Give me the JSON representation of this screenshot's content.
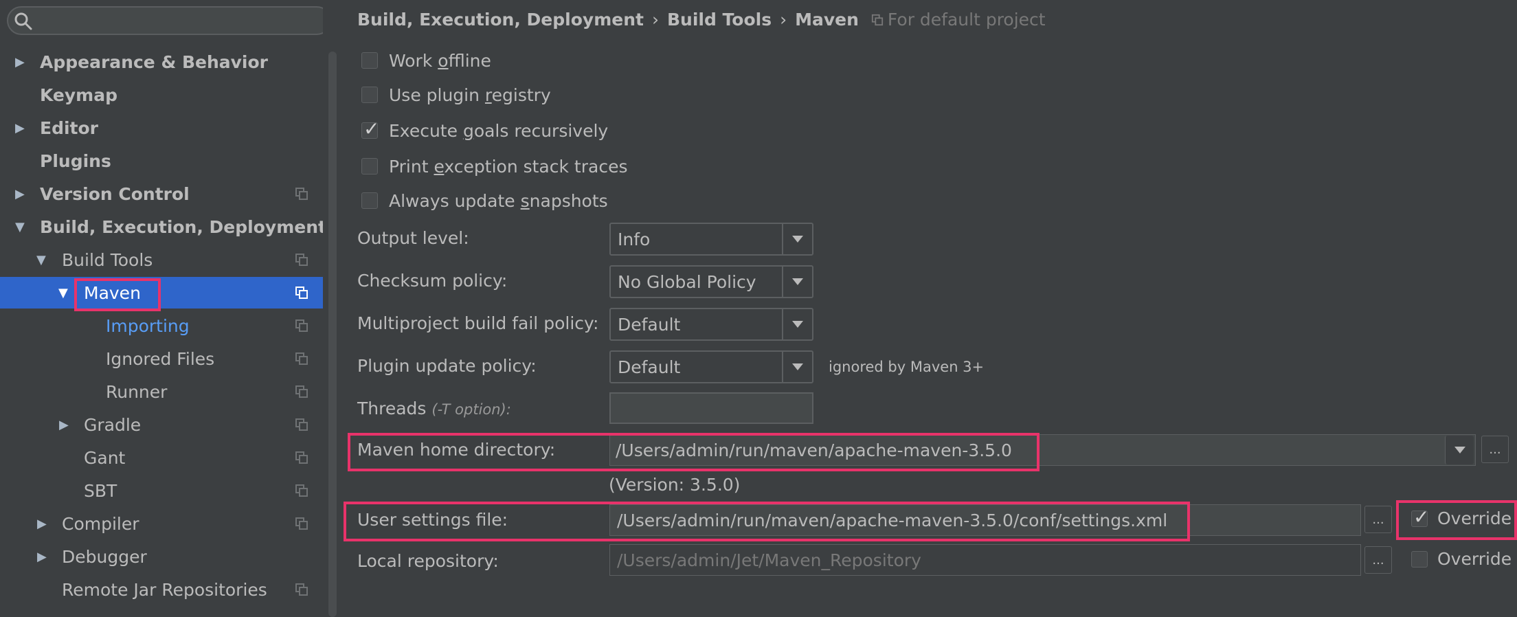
{
  "search": {
    "placeholder": "",
    "value": ""
  },
  "sidebar": {
    "items": [
      {
        "label": "Appearance & Behavior",
        "arrow": "▶"
      },
      {
        "label": "Keymap"
      },
      {
        "label": "Editor",
        "arrow": "▶"
      },
      {
        "label": "Plugins"
      },
      {
        "label": "Version Control",
        "arrow": "▶"
      },
      {
        "label": "Build, Execution, Deployment",
        "arrow": "▼"
      },
      {
        "label": "Build Tools",
        "arrow": "▼"
      },
      {
        "label": "Maven",
        "arrow": "▼"
      },
      {
        "label": "Importing"
      },
      {
        "label": "Ignored Files"
      },
      {
        "label": "Runner"
      },
      {
        "label": "Gradle",
        "arrow": "▶"
      },
      {
        "label": "Gant"
      },
      {
        "label": "SBT"
      },
      {
        "label": "Compiler",
        "arrow": "▶"
      },
      {
        "label": "Debugger",
        "arrow": "▶"
      },
      {
        "label": "Remote Jar Repositories"
      }
    ]
  },
  "breadcrumb": {
    "part1": "Build, Execution, Deployment",
    "part2": "Build Tools",
    "part3": "Maven",
    "separator": "›",
    "scope": "For default project"
  },
  "options": {
    "work_offline": {
      "pre": "Work ",
      "ul": "o",
      "post": "ffline",
      "checked": false
    },
    "use_plugin_registry": {
      "pre": "Use plugin ",
      "ul": "r",
      "post": "egistry",
      "checked": false
    },
    "execute_goals": {
      "pre": "Execute ",
      "ul": "g",
      "post": "oals recursively",
      "checked": true
    },
    "print_exception": {
      "pre": "Print ",
      "ul": "e",
      "post": "xception stack traces",
      "checked": false
    },
    "always_update": {
      "pre": "Always update ",
      "ul": "s",
      "post": "napshots",
      "checked": false
    }
  },
  "fields": {
    "output_level": {
      "label": "Output level:",
      "value": "Info"
    },
    "checksum_policy": {
      "label": "Checksum policy:",
      "value": "No Global Policy"
    },
    "multiproject": {
      "label": "Multiproject build fail policy:",
      "value": "Default"
    },
    "plugin_update": {
      "label": "Plugin update policy:",
      "value": "Default",
      "note": "ignored by Maven 3+"
    },
    "threads": {
      "label": "Threads",
      "hint": "(-T option):",
      "value": ""
    },
    "maven_home": {
      "label": "Maven home directory:",
      "value": "/Users/admin/run/maven/apache-maven-3.5.0",
      "version": "(Version: 3.5.0)"
    },
    "user_settings": {
      "label": "User settings file:",
      "value": "/Users/admin/run/maven/apache-maven-3.5.0/conf/settings.xml",
      "override_label": "Override",
      "override_checked": true
    },
    "local_repo": {
      "label": "Local repository:",
      "value": "/Users/admin/Jet/Maven_Repository",
      "override_label": "Override",
      "override_checked": false
    }
  },
  "ellipsis": "...",
  "colors": {
    "highlight": "#e8336a",
    "selection": "#2f65ca",
    "link": "#589df6"
  }
}
